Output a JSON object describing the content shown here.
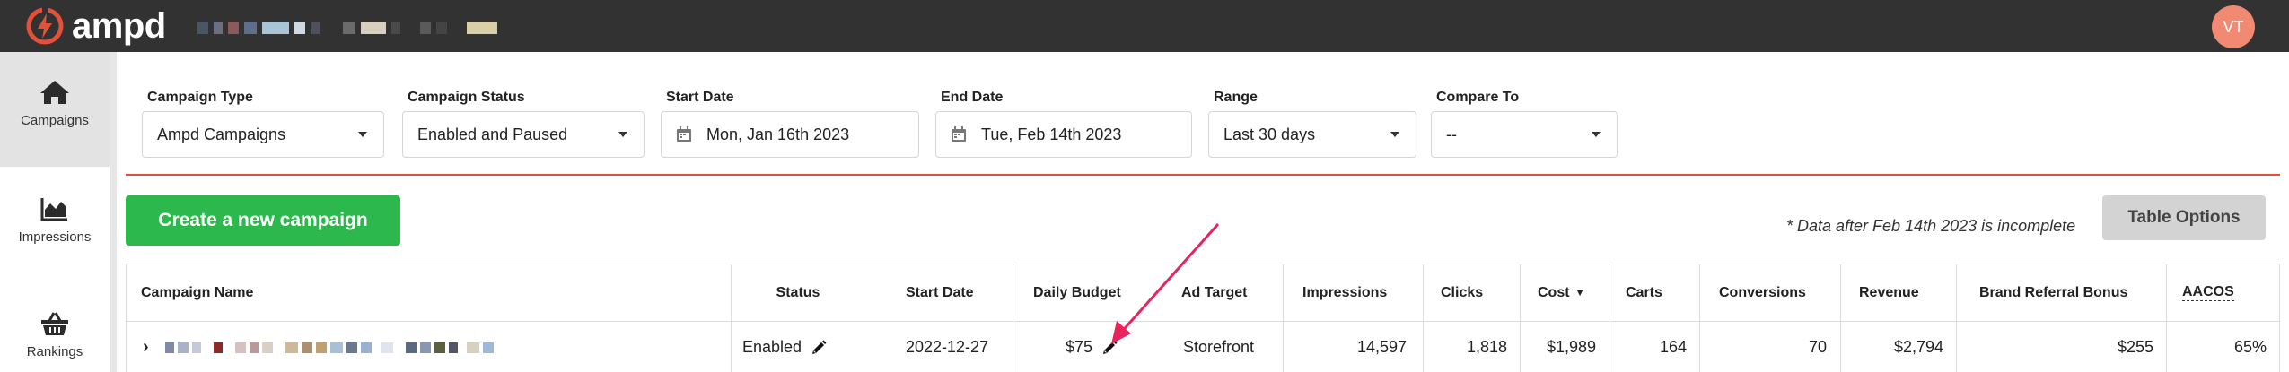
{
  "app": {
    "name": "ampd",
    "user_initials": "VT"
  },
  "colors": {
    "accent": "#e0533a",
    "create_button": "#2db84d",
    "link": "#2a6db4",
    "avatar": "#f08a72",
    "arrow": "#e8245f"
  },
  "sidebar": {
    "items": [
      {
        "label": "Campaigns",
        "icon": "home-icon",
        "active": true
      },
      {
        "label": "Impressions",
        "icon": "area-chart-icon",
        "active": false
      },
      {
        "label": "Rankings",
        "icon": "basket-icon",
        "active": false
      }
    ]
  },
  "filters": {
    "campaign_type": {
      "label": "Campaign Type",
      "value": "Ampd Campaigns"
    },
    "campaign_status": {
      "label": "Campaign Status",
      "value": "Enabled and Paused"
    },
    "start_date": {
      "label": "Start Date",
      "value": "Mon, Jan 16th 2023"
    },
    "end_date": {
      "label": "End Date",
      "value": "Tue, Feb 14th 2023"
    },
    "range": {
      "label": "Range",
      "value": "Last 30 days"
    },
    "compare_to": {
      "label": "Compare To",
      "value": "--"
    }
  },
  "toolbar": {
    "create_label": "Create a new campaign",
    "note": "* Data after Feb 14th 2023 is incomplete",
    "table_options_label": "Table Options"
  },
  "table": {
    "headers": {
      "campaign_name": "Campaign Name",
      "status": "Status",
      "start_date": "Start Date",
      "daily_budget": "Daily Budget",
      "ad_target": "Ad Target",
      "impressions": "Impressions",
      "clicks": "Clicks",
      "cost": "Cost",
      "carts": "Carts",
      "conversions": "Conversions",
      "revenue": "Revenue",
      "brand_referral_bonus": "Brand Referral Bonus",
      "aacos": "AACOS"
    },
    "sorted_by": "cost",
    "rows": [
      {
        "status": "Enabled",
        "start_date": "2022-12-27",
        "daily_budget": "$75",
        "ad_target": "Storefront",
        "impressions": "14,597",
        "clicks": "1,818",
        "cost": "$1,989",
        "carts": "164",
        "conversions": "70",
        "revenue": "$2,794",
        "brand_referral_bonus": "$255",
        "aacos": "65%"
      }
    ]
  }
}
